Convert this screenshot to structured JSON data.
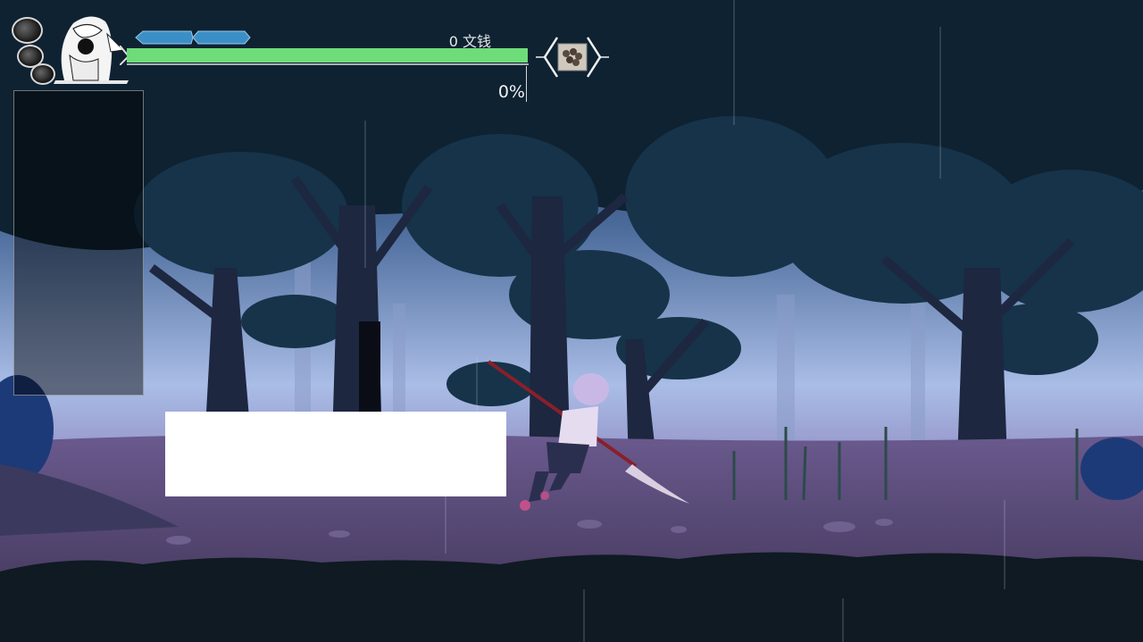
{
  "hud": {
    "money_text": "0 文钱",
    "progress_text": "0%",
    "hp_fraction": 1.0,
    "stamina_pips": 2,
    "item_slot_icon": "rock-pile-icon",
    "portrait_icon": "character-portrait-icon"
  },
  "dialog": {
    "text": ""
  },
  "colors": {
    "hp_bar": "#6fdc7a",
    "stamina_pip": "#3c8fc6",
    "sky": "#b9c8ec",
    "ground": "#4a3d63",
    "foreground": "#0f1a22"
  }
}
